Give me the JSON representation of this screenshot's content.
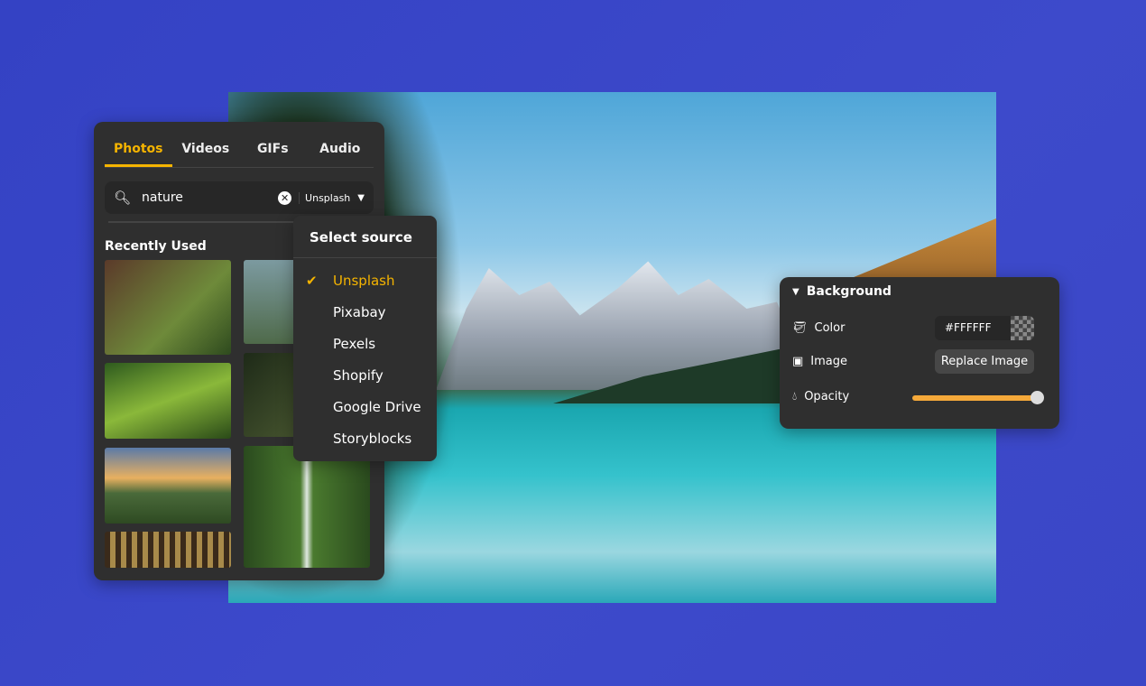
{
  "media_panel": {
    "tabs": [
      {
        "label": "Photos",
        "active": true
      },
      {
        "label": "Videos"
      },
      {
        "label": "GIFs"
      },
      {
        "label": "Audio"
      }
    ],
    "search": {
      "value": "nature",
      "source": "Unsplash"
    },
    "section_title": "Recently Used"
  },
  "source_dropdown": {
    "title": "Select source",
    "options": [
      "Unsplash",
      "Pixabay",
      "Pexels",
      "Shopify",
      "Google Drive",
      "Storyblocks"
    ],
    "selected": "Unsplash"
  },
  "background_panel": {
    "title": "Background",
    "color_label": "Color",
    "color_value": "#FFFFFF",
    "image_label": "Image",
    "replace_button": "Replace Image",
    "opacity_label": "Opacity",
    "opacity": 100
  },
  "colors": {
    "accent": "#f5b400",
    "slider": "#f5a93a",
    "page_bg": "#3b48c8",
    "panel": "#2f2f2f"
  }
}
